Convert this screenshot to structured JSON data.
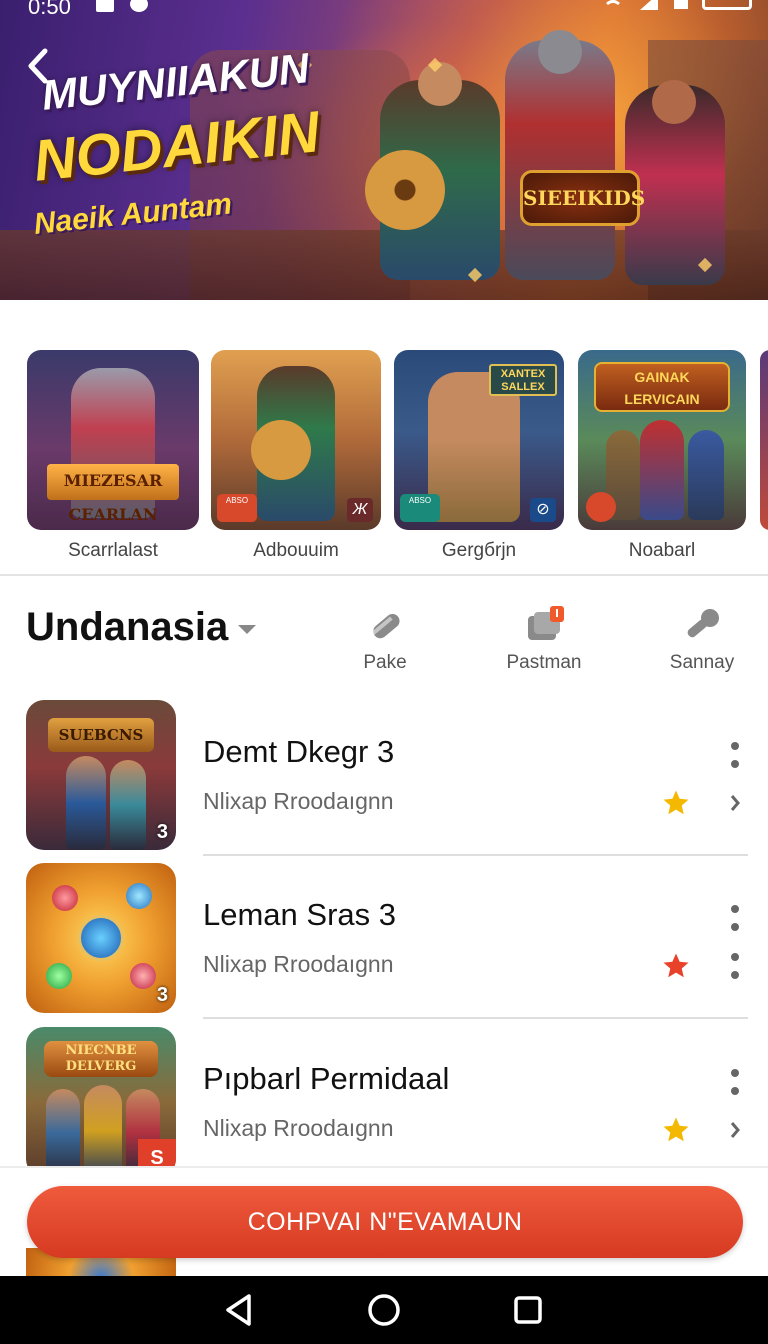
{
  "status_bar": {
    "time": "0:50"
  },
  "hero": {
    "title_line1": "MUYNIIAKUN",
    "title_line2": "NODAIKIN",
    "subtitle": "Naeik Auntam",
    "emblem": "SIEEIKIDS",
    "colors": {
      "title_white": "#ffffff",
      "title_yellow": "#ffd93b"
    }
  },
  "featured": [
    {
      "label": "Scarrlalast",
      "thumb_text": "MIEZESAR CEARLAN"
    },
    {
      "label": "Adbouuim",
      "thumb_badge": "ABSO"
    },
    {
      "label": "Gergбrjn",
      "thumb_text": "XANTEX SALLEX",
      "thumb_badge": "ABSO"
    },
    {
      "label": "Noabarl",
      "thumb_text": "GAINAK LERVICAIN"
    }
  ],
  "section": {
    "title": "Undanasia",
    "filters": [
      {
        "label": "Pake",
        "icon": "pencil-icon"
      },
      {
        "label": "Pastman",
        "icon": "notification-card-icon",
        "badge": "!"
      },
      {
        "label": "Sannay",
        "icon": "pen-icon"
      }
    ]
  },
  "list": [
    {
      "title": "Demt Dkegr 3",
      "subtitle": "Nlixap Rroodaıgnn",
      "star_color": "#f5b800",
      "thumb_num": "3",
      "thumb_text": "SUEBCNS"
    },
    {
      "title": "Leman Sras 3",
      "subtitle": "Nlixap Rroodaıgnn",
      "star_color": "#e8432a",
      "thumb_num": "3"
    },
    {
      "title": "Pıpbarl Permidaal",
      "subtitle": "Nlixap Rroodaıgnn",
      "star_color": "#f5b800",
      "thumb_text": "NIECNBE DELVERG",
      "thumb_badge": "S"
    }
  ],
  "cta": {
    "label": "COHPVAI N\"EVAMAUN",
    "color": "#e44a2e"
  }
}
